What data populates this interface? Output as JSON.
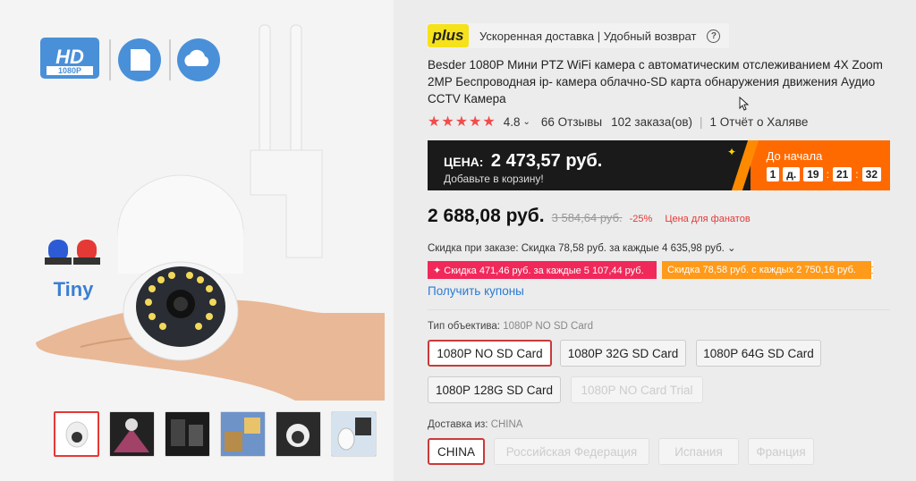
{
  "gallery": {
    "badges": {
      "hd_top": "HD",
      "hd_bottom": "1080P"
    },
    "tiny_label": "Tiny",
    "thumbnails": [
      "thumb-1",
      "thumb-2",
      "thumb-3",
      "thumb-4",
      "thumb-5",
      "thumb-6"
    ],
    "active_thumbnail": 0
  },
  "plus": {
    "badge": "plus",
    "text": "Ускоренная доставка | Удобный возврат",
    "help_icon": "?"
  },
  "product": {
    "title": "Besder 1080P Мини PTZ WiFi камера с автоматическим отслеживанием 4X Zoom 2MP Беспроводная ip- камера облачно-SD карта обнаружения движения Аудио CCTV Камера",
    "rating": "4.8",
    "stars": 5,
    "reviews": "66 Отзывы",
    "orders": "102 заказа(ов)",
    "report": "1 Отчёт о Халяве"
  },
  "promo": {
    "price_label": "ЦЕНА:",
    "price": "2 473,57 руб.",
    "sub": "Добавьте в корзину!",
    "start_label": "До начала",
    "timer": {
      "days": "1",
      "days_unit": "д.",
      "hours": "19",
      "minutes": "21",
      "seconds": "32"
    }
  },
  "price": {
    "current": "2 688,08 руб.",
    "old": "3 584,64 руб.",
    "discount": "-25%",
    "fans": "Цена для фанатов"
  },
  "order_discount": "Скидка при заказе: Скидка 78,58 руб. за каждые 4 635,98 руб. ⌄",
  "coupons": [
    {
      "text": "✦ Скидка 471,46 руб. за каждые 5 107,44 руб.",
      "color": "#f0295a"
    },
    {
      "text": "Скидка 78,58 руб. с каждых 2 750,16 руб.",
      "color": "#ff9a1a"
    }
  ],
  "get_coupons": "Получить купоны",
  "lens_type": {
    "label": "Тип объектива:",
    "value": "1080P NO SD Card",
    "options": [
      "1080P NO SD Card",
      "1080P 32G SD Card",
      "1080P 64G SD Card",
      "1080P 128G SD Card",
      "1080P NO Card Trial"
    ]
  },
  "ship_from": {
    "label": "Доставка из:",
    "value": "CHINA",
    "options": [
      "CHINA",
      "Российская Федерация",
      "Испания",
      "Франция"
    ]
  }
}
